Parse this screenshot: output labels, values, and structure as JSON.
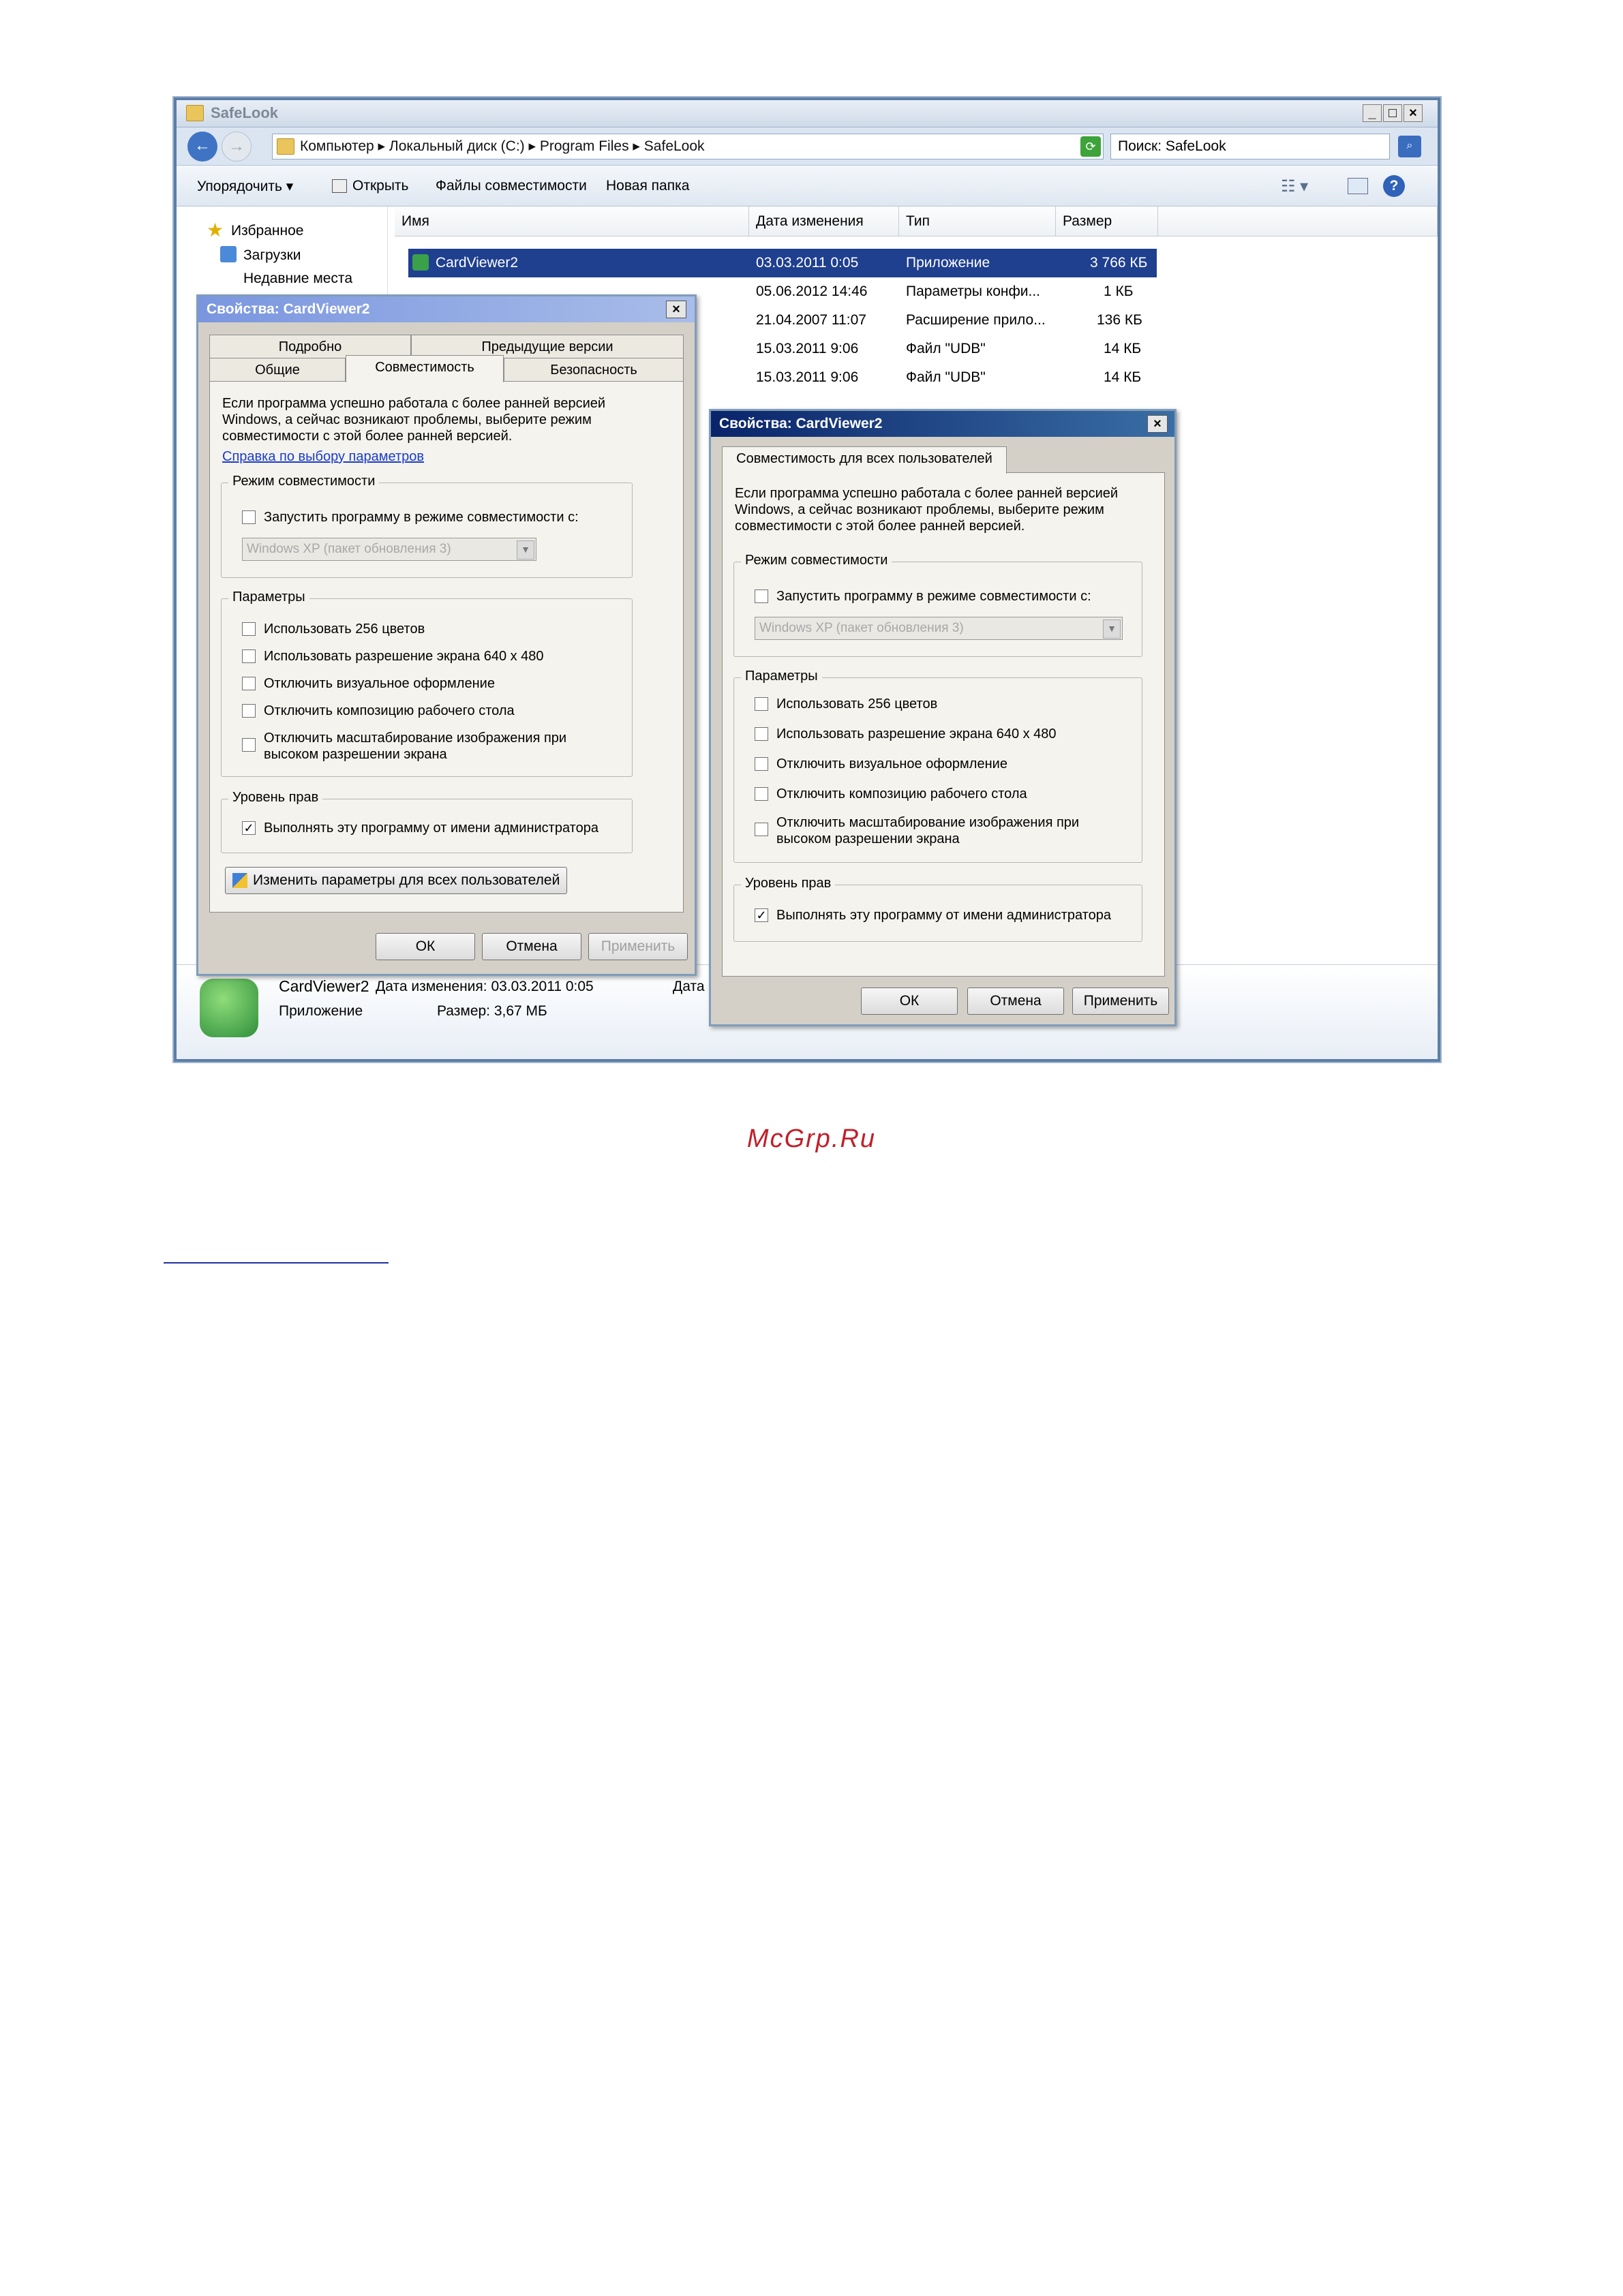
{
  "explorer": {
    "title": "SafeLook",
    "breadcrumb": [
      "Компьютер",
      "Локальный диск (C:)",
      "Program Files",
      "SafeLook"
    ],
    "search_placeholder": "Поиск: SafeLook",
    "toolbar": [
      "Упорядочить ▾",
      "Открыть",
      "Файлы совместимости",
      "Новая папка"
    ],
    "nav": [
      "Избранное",
      "Загрузки",
      "Недавние места"
    ],
    "columns": [
      "Имя",
      "Дата изменения",
      "Тип",
      "Размер"
    ],
    "rows": [
      {
        "name": "CardViewer2",
        "date": "03.03.2011 0:05",
        "type": "Приложение",
        "size": "3 766 КБ",
        "selected": true
      },
      {
        "name": "",
        "date": "05.06.2012 14:46",
        "type": "Параметры конфи...",
        "size": "1 КБ"
      },
      {
        "name": "",
        "date": "21.04.2007 11:07",
        "type": "Расширение прило...",
        "size": "136 КБ"
      },
      {
        "name": "",
        "date": "15.03.2011 9:06",
        "type": "Файл \"UDB\"",
        "size": "14 КБ"
      },
      {
        "name": "",
        "date": "15.03.2011 9:06",
        "type": "Файл \"UDB\"",
        "size": "14 КБ"
      }
    ],
    "details": {
      "name": "CardViewer2",
      "date_label": "Дата изменения: 03.03.2011 0:05",
      "type": "Приложение",
      "size_label": "Размер: 3,67 МБ",
      "extra": "Дата"
    }
  },
  "dialog1": {
    "title": "Свойства: CardViewer2",
    "tabs_top": [
      "Подробно",
      "Предыдущие версии"
    ],
    "tabs_bottom": [
      "Общие",
      "Совместимость",
      "Безопасность"
    ],
    "intro": "Если программа успешно работала с более ранней версией Windows, а сейчас возникают проблемы, выберите режим совместимости с этой более ранней версией.",
    "help_link": "Справка по выбору параметров",
    "compat_group": "Режим совместимости",
    "compat_check": "Запустить программу в режиме совместимости с:",
    "compat_combo": "Windows XP (пакет обновления 3)",
    "params_group": "Параметры",
    "params": [
      "Использовать 256 цветов",
      "Использовать разрешение экрана 640 x 480",
      "Отключить визуальное оформление",
      "Отключить композицию рабочего стола",
      "Отключить масштабирование изображения при высоком разрешении экрана"
    ],
    "rights_group": "Уровень прав",
    "rights_check": "Выполнять эту программу от имени администратора",
    "all_users_button": "Изменить параметры для всех пользователей",
    "ok": "ОК",
    "cancel": "Отмена",
    "apply": "Применить"
  },
  "dialog2": {
    "title": "Свойства: CardViewer2",
    "tab": "Совместимость для всех пользователей",
    "intro": "Если программа успешно работала с более ранней версией Windows, а сейчас возникают проблемы, выберите режим совместимости с этой более ранней версией.",
    "compat_group": "Режим совместимости",
    "compat_check": "Запустить программу в режиме совместимости с:",
    "compat_combo": "Windows XP (пакет обновления 3)",
    "params_group": "Параметры",
    "params": [
      "Использовать 256 цветов",
      "Использовать разрешение экрана 640 x 480",
      "Отключить визуальное оформление",
      "Отключить композицию рабочего стола",
      "Отключить масштабирование изображения при высоком разрешении экрана"
    ],
    "rights_group": "Уровень прав",
    "rights_check": "Выполнять эту программу от имени администратора",
    "ok": "ОК",
    "cancel": "Отмена",
    "apply": "Применить"
  },
  "watermark": "McGrp.Ru",
  "colors": {
    "selection": "#1f3f8f",
    "title_active": "#0a246a",
    "title_inactive": "#7a96df"
  }
}
